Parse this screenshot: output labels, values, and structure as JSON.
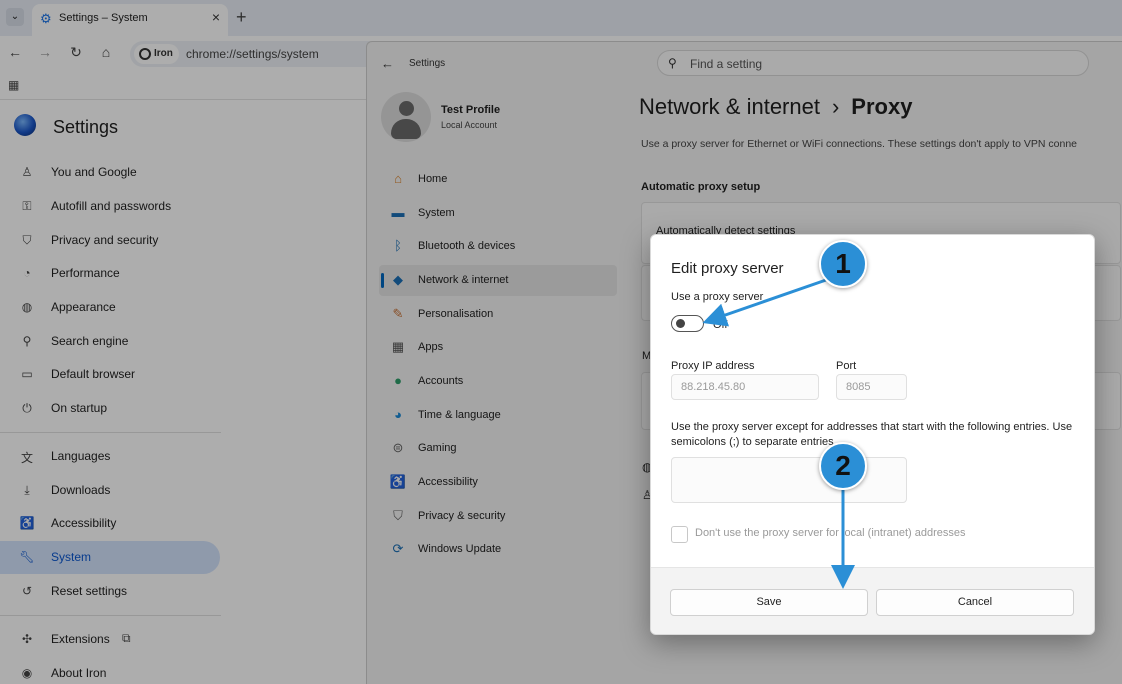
{
  "browser": {
    "tab_title": "Settings – System",
    "tab_icon": "gear-icon",
    "site_chip": "Iron",
    "url": "chrome://settings/system"
  },
  "chrome_settings": {
    "title": "Settings",
    "items": [
      {
        "label": "You and Google",
        "icon": "person-icon"
      },
      {
        "label": "Autofill and passwords",
        "icon": "key-icon"
      },
      {
        "label": "Privacy and security",
        "icon": "shield-icon"
      },
      {
        "label": "Performance",
        "icon": "gauge-icon"
      },
      {
        "label": "Appearance",
        "icon": "palette-icon"
      },
      {
        "label": "Search engine",
        "icon": "search-icon"
      },
      {
        "label": "Default browser",
        "icon": "browser-icon"
      },
      {
        "label": "On startup",
        "icon": "power-icon"
      },
      {
        "label": "Languages",
        "icon": "translate-icon"
      },
      {
        "label": "Downloads",
        "icon": "download-icon"
      },
      {
        "label": "Accessibility",
        "icon": "accessibility-icon"
      },
      {
        "label": "System",
        "icon": "wrench-icon",
        "active": true
      },
      {
        "label": "Reset settings",
        "icon": "reset-icon"
      },
      {
        "label": "Extensions",
        "icon": "puzzle-icon"
      },
      {
        "label": "About Iron",
        "icon": "info-icon"
      }
    ]
  },
  "windows_settings": {
    "app_title": "Settings",
    "search_placeholder": "Find a setting",
    "profile_name": "Test Profile",
    "profile_type": "Local Account",
    "nav": [
      {
        "label": "Home",
        "icon": "home-icon",
        "color": "#d9822b"
      },
      {
        "label": "System",
        "icon": "monitor-icon",
        "color": "#1b6fb5"
      },
      {
        "label": "Bluetooth & devices",
        "icon": "bluetooth-icon",
        "color": "#1b6fb5"
      },
      {
        "label": "Network & internet",
        "icon": "wifi-icon",
        "color": "#1b6fb5",
        "active": true
      },
      {
        "label": "Personalisation",
        "icon": "brush-icon",
        "color": "#c9743a"
      },
      {
        "label": "Apps",
        "icon": "apps-icon",
        "color": "#555555"
      },
      {
        "label": "Accounts",
        "icon": "account-icon",
        "color": "#2e9e6b"
      },
      {
        "label": "Time & language",
        "icon": "globe-icon",
        "color": "#1b8ad6"
      },
      {
        "label": "Gaming",
        "icon": "gamepad-icon",
        "color": "#666666"
      },
      {
        "label": "Accessibility",
        "icon": "accessibility-icon",
        "color": "#1b6fb5"
      },
      {
        "label": "Privacy & security",
        "icon": "shield-icon",
        "color": "#666666"
      },
      {
        "label": "Windows Update",
        "icon": "update-icon",
        "color": "#1b6fb5"
      }
    ],
    "breadcrumb_parent": "Network & internet",
    "breadcrumb_sep": "›",
    "breadcrumb_current": "Proxy",
    "description": "Use a proxy server for Ethernet or WiFi connections. These settings don't apply to VPN conne",
    "section_auto": "Automatic proxy setup",
    "auto_detect": "Automatically detect settings",
    "manual_section_peek": "M"
  },
  "dialog": {
    "title": "Edit proxy server",
    "use_proxy_label": "Use a proxy server",
    "toggle_state": "Off",
    "ip_label": "Proxy IP address",
    "ip_value": "88.218.45.80",
    "port_label": "Port",
    "port_value": "8085",
    "exceptions_note": "Use the proxy server except for addresses that start with the following entries. Use semicolons (;) to separate entries.",
    "exceptions_value": "",
    "local_checkbox_label": "Don't use the proxy server for local (intranet) addresses",
    "save_label": "Save",
    "cancel_label": "Cancel"
  },
  "annotations": {
    "step1": "1",
    "step2": "2",
    "color": "#2b8fd6"
  }
}
